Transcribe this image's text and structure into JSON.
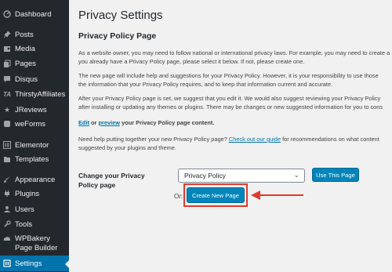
{
  "sidebar": {
    "items": [
      {
        "label": "Dashboard",
        "icon": "dashboard-icon"
      },
      {
        "label": "Posts",
        "icon": "pin-icon"
      },
      {
        "label": "Media",
        "icon": "media-icon"
      },
      {
        "label": "Pages",
        "icon": "pages-icon"
      },
      {
        "label": "Disqus",
        "icon": "comment-icon"
      },
      {
        "label": "ThirstyAffiliates",
        "icon": "ta-icon"
      },
      {
        "label": "JReviews",
        "icon": "star-icon"
      },
      {
        "label": "weForms",
        "icon": "forms-icon"
      },
      {
        "label": "Elementor",
        "icon": "elementor-icon"
      },
      {
        "label": "Templates",
        "icon": "folder-icon"
      },
      {
        "label": "Appearance",
        "icon": "brush-icon"
      },
      {
        "label": "Plugins",
        "icon": "plugin-icon"
      },
      {
        "label": "Users",
        "icon": "user-icon"
      },
      {
        "label": "Tools",
        "icon": "wrench-icon"
      },
      {
        "label": "WPBakery Page Builder",
        "icon": "cloud-icon"
      },
      {
        "label": "Settings",
        "icon": "settings-icon",
        "active": true
      }
    ]
  },
  "main": {
    "title": "Privacy Settings",
    "section_title": "Privacy Policy Page",
    "p1_l1": "As a website owner, you may need to follow national or international privacy laws. For example, you may need to create a",
    "p1_l2": "you already have a Privacy Policy page, please select it below. If not, please create one.",
    "p2_l1": "The new page will include help and suggestions for your Privacy Policy. However, it is your responsibility to use those",
    "p2_l2": "the information that your Privacy Policy requires, and to keep that information current and accurate.",
    "p3_l1": "After your Privacy Policy page is set, we suggest that you edit it. We would also suggest reviewing your Privacy Policy",
    "p3_l2": "after installing or updating any themes or plugins. There may be changes or new suggested information for you to cons",
    "edit_link": "Edit",
    "or_word": "or",
    "preview_link": "preview",
    "edit_suffix": "your Privacy Policy page content.",
    "help_prefix": "Need help putting together your new Privacy Policy page?",
    "help_link": "Check out our guide",
    "help_suffix": "for recommendations on what content",
    "help_l2": "suggested by your plugins and theme.",
    "field_label": "Change your Privacy Policy page",
    "select_value": "Privacy Policy",
    "use_button": "Use This Page",
    "or_text": "Or:",
    "create_button": "Create New Page"
  },
  "colors": {
    "sidebar_bg": "#23282d",
    "active_bg": "#0073aa",
    "button_bg": "#0085ba",
    "annotation": "#e03a2f"
  }
}
